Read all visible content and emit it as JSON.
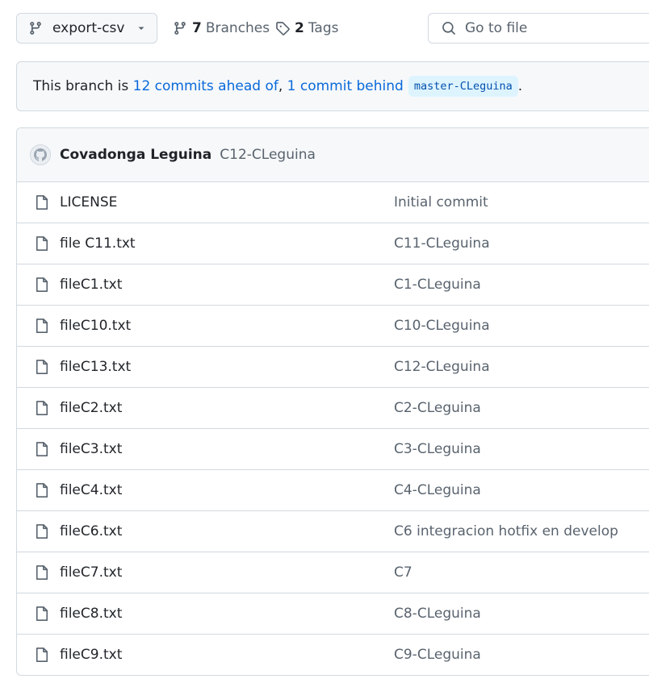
{
  "branch": {
    "name": "export-csv"
  },
  "branches": {
    "count": "7",
    "label": "Branches"
  },
  "tags": {
    "count": "2",
    "label": "Tags"
  },
  "search": {
    "placeholder": "Go to file"
  },
  "banner": {
    "prefix": "This branch is ",
    "ahead": "12 commits ahead of",
    "sep": ", ",
    "behind": "1 commit behind",
    "target": "master-CLeguina",
    "suffix": "."
  },
  "latest_commit": {
    "author": "Covadonga Leguina",
    "message": "C12-CLeguina"
  },
  "files": [
    {
      "name": "LICENSE",
      "message": "Initial commit"
    },
    {
      "name": "file C11.txt",
      "message": "C11-CLeguina"
    },
    {
      "name": "fileC1.txt",
      "message": "C1-CLeguina"
    },
    {
      "name": "fileC10.txt",
      "message": "C10-CLeguina"
    },
    {
      "name": "fileC13.txt",
      "message": "C12-CLeguina"
    },
    {
      "name": "fileC2.txt",
      "message": "C2-CLeguina"
    },
    {
      "name": "fileC3.txt",
      "message": "C3-CLeguina"
    },
    {
      "name": "fileC4.txt",
      "message": "C4-CLeguina"
    },
    {
      "name": "fileC6.txt",
      "message": "C6 integracion hotfix en develop"
    },
    {
      "name": "fileC7.txt",
      "message": "C7"
    },
    {
      "name": "fileC8.txt",
      "message": "C8-CLeguina"
    },
    {
      "name": "fileC9.txt",
      "message": "C9-CLeguina"
    }
  ],
  "colors": {
    "link": "#0969da",
    "muted": "#59636e",
    "border": "#d1d9e0",
    "code_bg": "#ddf4ff"
  }
}
